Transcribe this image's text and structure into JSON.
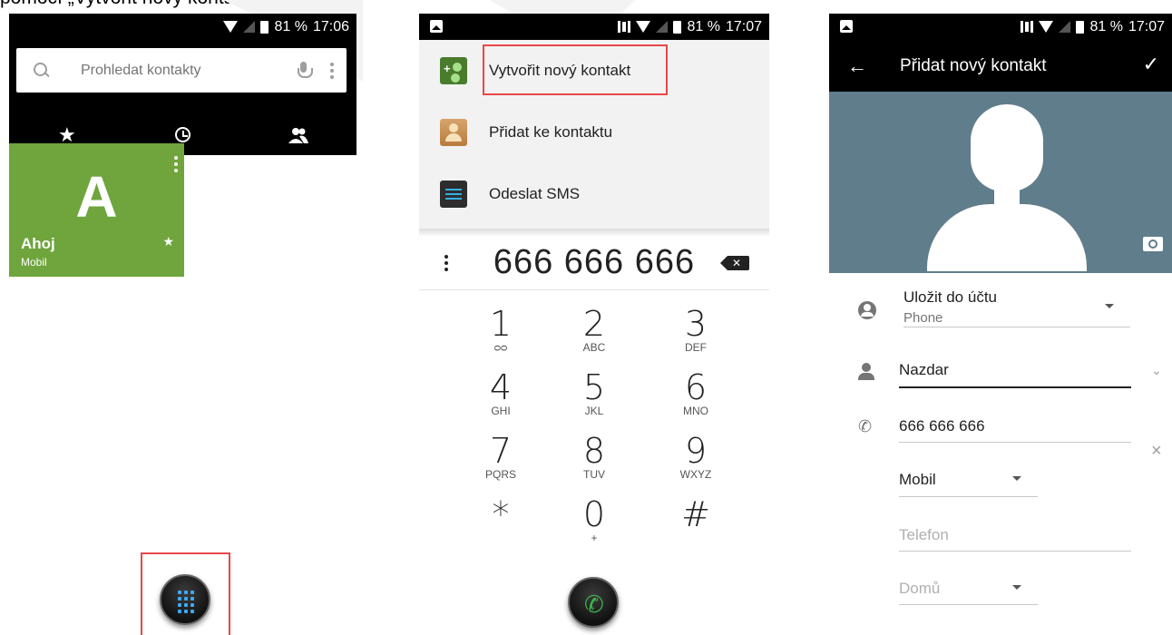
{
  "caption": "pomocí „Vytvořit nový kontakt“.",
  "status1": {
    "battery": "81 %",
    "time": "17:06"
  },
  "status2": {
    "battery": "81 %",
    "time": "17:07"
  },
  "status3": {
    "battery": "81 %",
    "time": "17:07"
  },
  "contacts": {
    "search_placeholder": "Prohledat kontakty",
    "tabs": [
      "favorites",
      "recents",
      "contacts"
    ],
    "favorite": {
      "initial": "A",
      "name": "Ahoj",
      "type": "Mobil"
    }
  },
  "dialer": {
    "menu": [
      {
        "label": "Vytvořit nový kontakt",
        "icon": "add-contact-icon"
      },
      {
        "label": "Přidat ke kontaktu",
        "icon": "contact-card-icon"
      },
      {
        "label": "Odeslat SMS",
        "icon": "sms-icon"
      }
    ],
    "number": "666 666 666",
    "keys": [
      {
        "d": "1",
        "l": "ᴑᴑ"
      },
      {
        "d": "2",
        "l": "ABC"
      },
      {
        "d": "3",
        "l": "DEF"
      },
      {
        "d": "4",
        "l": "GHI"
      },
      {
        "d": "5",
        "l": "JKL"
      },
      {
        "d": "6",
        "l": "MNO"
      },
      {
        "d": "7",
        "l": "PQRS"
      },
      {
        "d": "8",
        "l": "TUV"
      },
      {
        "d": "9",
        "l": "WXYZ"
      },
      {
        "d": "*",
        "l": ""
      },
      {
        "d": "0",
        "l": "+"
      },
      {
        "d": "#",
        "l": ""
      }
    ]
  },
  "new_contact": {
    "title": "Přidat nový kontakt",
    "account_label": "Uložit do účtu",
    "account_value": "Phone",
    "name_value": "Nazdar",
    "phone_value": "666 666 666",
    "phone_type": "Mobil",
    "phone2_placeholder": "Telefon",
    "phone2_type": "Domů"
  },
  "colors": {
    "tile_green": "#6fa53c",
    "highlight_red": "#e8464a",
    "photo_bg": "#607d8b",
    "call_green": "#3ab54a"
  }
}
